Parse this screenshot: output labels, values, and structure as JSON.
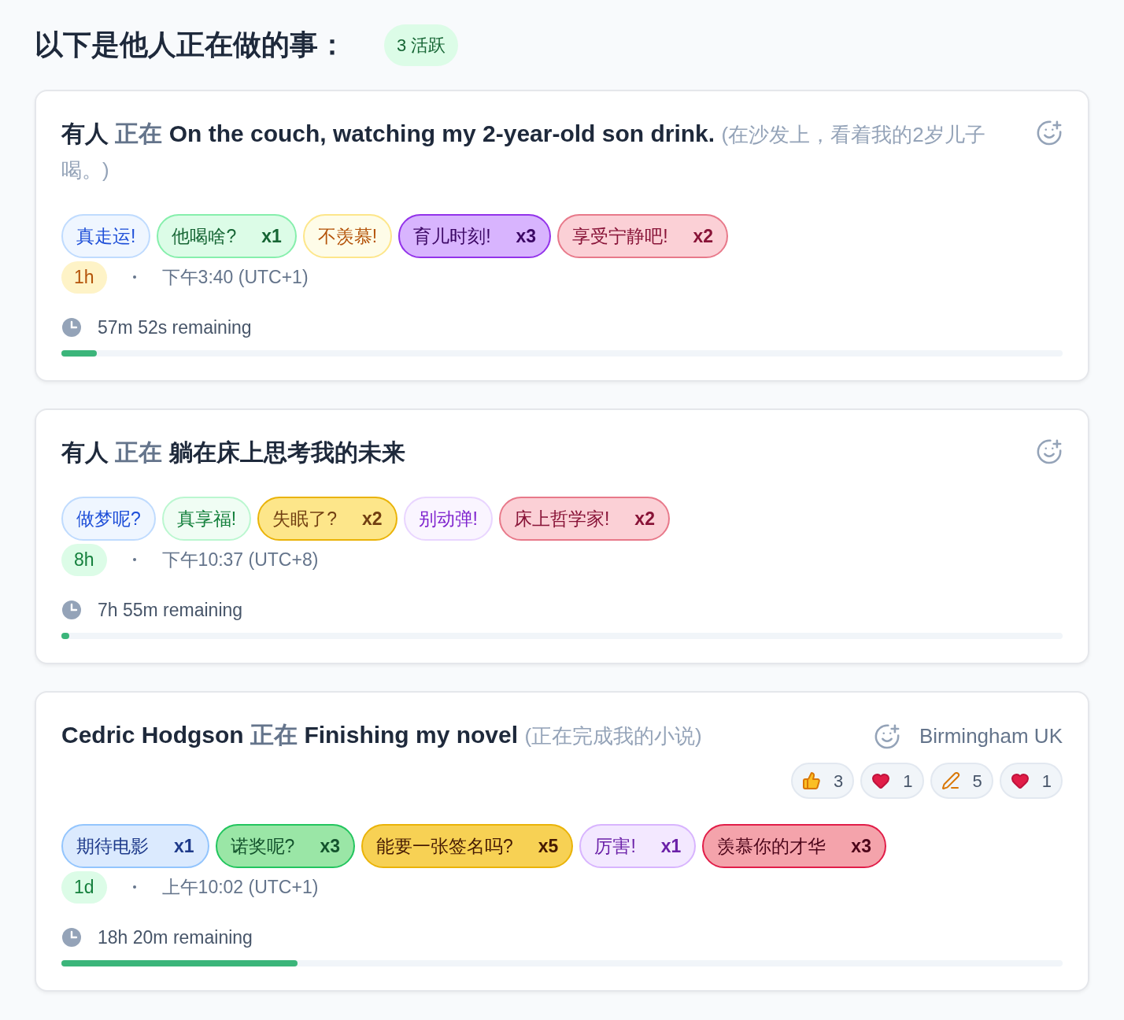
{
  "header": {
    "title": "以下是他人正在做的事：",
    "badge": "3 活跃"
  },
  "cards": [
    {
      "actor": "有人",
      "verb": "正在",
      "activity": "On the couch, watching my 2-year-old son drink.",
      "translation": "(在沙发上，看着我的2岁儿子喝。)",
      "tags": [
        {
          "label": "真走运!",
          "color": "#eff6ff",
          "kind": "blue"
        },
        {
          "label": "他喝啥?",
          "count": "x1",
          "color": "#dcfce7",
          "kind": "green"
        },
        {
          "label": "不羡慕!",
          "color": "#fefce8",
          "kind": "amber"
        },
        {
          "label": "育儿时刻!",
          "count": "x3",
          "color": "#d8b4fe",
          "kind": "purplestrong"
        },
        {
          "label": "享受宁静吧!",
          "count": "x2",
          "color": "#fbd0d6",
          "kind": "red"
        }
      ],
      "age": {
        "label": "1h",
        "color": "#fef3c7",
        "kind": "amber"
      },
      "time": "下午3:40 (UTC+1)",
      "remaining": "57m 52s remaining",
      "level": 0.035
    },
    {
      "actor": "有人",
      "verb": "正在",
      "activity": "躺在床上思考我的未来",
      "tags": [
        {
          "label": "做梦呢?",
          "color": "#eff6ff",
          "kind": "blue"
        },
        {
          "label": "真享福!",
          "color": "#f0fdf4",
          "kind": "greenlight"
        },
        {
          "label": "失眠了?",
          "count": "x2",
          "color": "#fde68a",
          "kind": "yellow"
        },
        {
          "label": "别动弹!",
          "color": "#faf5ff",
          "kind": "purple"
        },
        {
          "label": "床上哲学家!",
          "count": "x2",
          "color": "#fbd0d6",
          "kind": "red"
        }
      ],
      "age": {
        "label": "8h",
        "color": "#dcfce7",
        "kind": "green"
      },
      "time": "下午10:37 (UTC+8)",
      "remaining": "7h 55m remaining",
      "level": 0.008
    },
    {
      "actor": "Cedric Hodgson",
      "verb": "正在",
      "activity": "Finishing my novel",
      "translation": "(正在完成我的小说)",
      "location": "Birmingham UK",
      "reactions": [
        {
          "kind": "thumbs",
          "count": "3"
        },
        {
          "kind": "heart",
          "count": "1"
        },
        {
          "kind": "writing",
          "count": "5"
        },
        {
          "kind": "heart",
          "count": "1"
        }
      ],
      "tags": [
        {
          "label": "期待电影",
          "count": "x1",
          "color": "#dbeafe",
          "kind": "bluemid"
        },
        {
          "label": "诺奖呢?",
          "count": "x3",
          "color": "#9ae6a6",
          "kind": "greenstrong"
        },
        {
          "label": "能要一张签名吗?",
          "count": "x5",
          "color": "#f7d154",
          "kind": "yellowstrong"
        },
        {
          "label": "厉害!",
          "count": "x1",
          "color": "#f3e8ff",
          "kind": "purplemid"
        },
        {
          "label": "羡慕你的才华",
          "count": "x3",
          "color": "#f4a3ab",
          "kind": "redstrong"
        }
      ],
      "age": {
        "label": "1d",
        "color": "#dcfce7",
        "kind": "green"
      },
      "time": "上午10:02 (UTC+1)",
      "remaining": "18h 20m remaining",
      "level": 0.236
    }
  ]
}
